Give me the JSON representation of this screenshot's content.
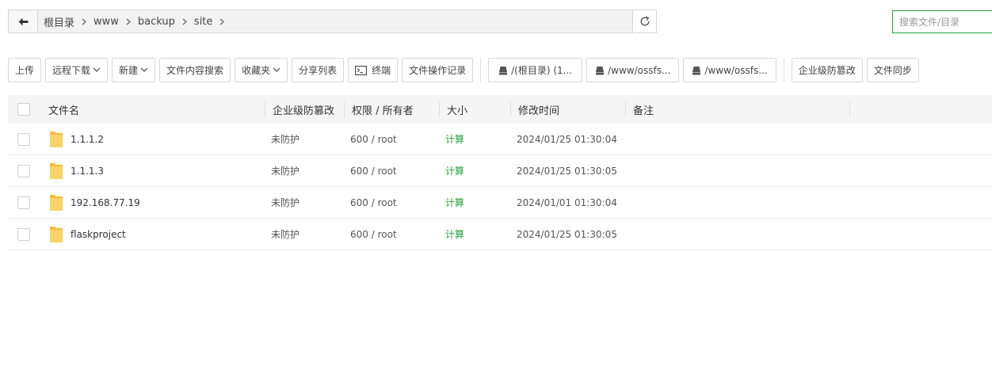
{
  "pathbar": {
    "crumbs": [
      "根目录",
      "www",
      "backup",
      "site"
    ]
  },
  "search": {
    "placeholder": "搜索文件/目录"
  },
  "toolbar": {
    "upload": "上传",
    "remote_download": "远程下载",
    "new": "新建",
    "content_search": "文件内容搜索",
    "favorites": "收藏夹",
    "share_list": "分享列表",
    "terminal": "终端",
    "op_log": "文件操作记录",
    "disk1": "/(根目录) (1...",
    "disk2": "/www/ossfs...",
    "disk3": "/www/ossfs...",
    "tamper": "企业级防篡改",
    "sync": "文件同步"
  },
  "table": {
    "headers": {
      "name": "文件名",
      "tamper": "企业级防篡改",
      "perm": "权限 / 所有者",
      "size": "大小",
      "mtime": "修改时间",
      "note": "备注"
    },
    "rows": [
      {
        "name": "1.1.1.2",
        "tamper": "未防护",
        "perm": "600 / root",
        "size": "计算",
        "mtime": "2024/01/25 01:30:04"
      },
      {
        "name": "1.1.1.3",
        "tamper": "未防护",
        "perm": "600 / root",
        "size": "计算",
        "mtime": "2024/01/25 01:30:05"
      },
      {
        "name": "192.168.77.19",
        "tamper": "未防护",
        "perm": "600 / root",
        "size": "计算",
        "mtime": "2024/01/01 01:30:04"
      },
      {
        "name": "flaskproject",
        "tamper": "未防护",
        "perm": "600 / root",
        "size": "计算",
        "mtime": "2024/01/25 01:30:05"
      }
    ]
  },
  "colors": {
    "accent": "#20a53a",
    "folder": "#f5c542"
  }
}
